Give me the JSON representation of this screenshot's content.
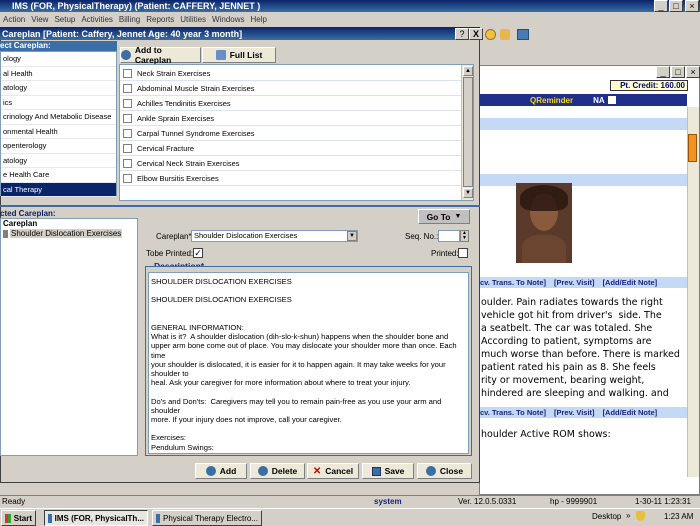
{
  "main_title": "IMS (FOR, PhysicalTherapy)   (Patient: CAFFERY, JENNET )",
  "menu": [
    "Action",
    "View",
    "Setup",
    "Activities",
    "Billing",
    "Reports",
    "Utilities",
    "Windows",
    "Help"
  ],
  "dialog": {
    "title": "Careplan  [Patient: Caffery, Jennet   Age: 40 year 3 month]",
    "help_btn": "?",
    "close_btn": "X",
    "select_label": "ect Careplan:",
    "add_to_careplan": "Add to Careplan",
    "full_list": "Full List",
    "categories": [
      "ology",
      "al Health",
      "atology",
      "ics",
      "crinology And Metabolic Disease",
      "onmental Health",
      "openterology",
      "atology",
      "e Health Care",
      "cal Therapy"
    ],
    "careplans": [
      "Neck Strain Exercises",
      "Abdominal Muscle Strain Exercises",
      "Achilles Tendinitis Exercises",
      "Ankle Sprain Exercises",
      "Carpal Tunnel Syndrome Exercises",
      "Cervical Fracture",
      "Cervical Neck Strain Exercises",
      "Elbow Bursitis Exercises"
    ],
    "selected_label": "cted Careplan:",
    "tree_root": "Careplan",
    "tree_child": "Shoulder Dislocation Exercises",
    "go_to": "Go To",
    "careplan_label": "Careplan*",
    "careplan_value": "Shoulder Dislocation Exercises",
    "seq_label": "Seq. No.:",
    "tobe_label": "Tobe Printed:",
    "tobe_checked": "✓",
    "printed_label": "Printed:",
    "desc_label": "Description*",
    "description": "SHOULDER DISLOCATION EXERCISES\n\nSHOULDER DISLOCATION EXERCISES\n\n\nGENERAL INFORMATION:\nWhat is it?  A shoulder dislocation (dih-slo-k-shun) happens when the shoulder bone and\nupper arm bone come out of place. You may dislocate your shoulder more than once. Each time\nyour shoulder is dislocated, it is easier for it to happen again. It may take weeks for your shoulder to\nheal. Ask your caregiver for more information about where to treat your injury.\n\nDo's and Don'ts:  Caregivers may tell you to remain pain-free as you use your arm and shoulder\nmore. If your injury does not improve, call your caregiver.\n\nExercises:\nPendulum Swings:\n\nLeaning over the edge of a table and supporting your body weight with the uninjured arm, gently\nswing your injured arm:",
    "buttons": {
      "add": "Add",
      "delete": "Delete",
      "cancel": "Cancel",
      "save": "Save",
      "close": "Close"
    }
  },
  "right": {
    "pt_credit": "Pt. Credit:  160.00",
    "qreminder": "QReminder",
    "na": "NA",
    "links1": [
      "cv. Trans. To Note]",
      "[Prev. Visit]",
      "[Add/Edit Note]"
    ],
    "text1": "oulder. Pain radiates towards the right\nvehicle got hit from driver's  side. The\na seatbelt. The car was totaled. She\nAccording to patient, symptoms are\nmuch worse than before. There is marked\npatient rated his pain as 8. She feels\nrity or movement, bearing weight,\nhindered are sleeping and walking. and",
    "links2": [
      "cv. Trans. To Note]",
      "[Prev. Visit]",
      "[Add/Edit Note]"
    ],
    "text2": "houlder Active ROM shows:"
  },
  "statusbar": {
    "ready": "Ready",
    "system": "system",
    "version": "Ver. 12.0.5.0331",
    "host": "hp - 9999901",
    "datetime": "1-30-11 1:23:31"
  },
  "taskbar": {
    "start": "Start",
    "task1": "IMS (FOR, PhysicalTh...",
    "task2": "Physical Therapy Electro...",
    "desktop": "Desktop",
    "clock": "1:23 AM"
  }
}
